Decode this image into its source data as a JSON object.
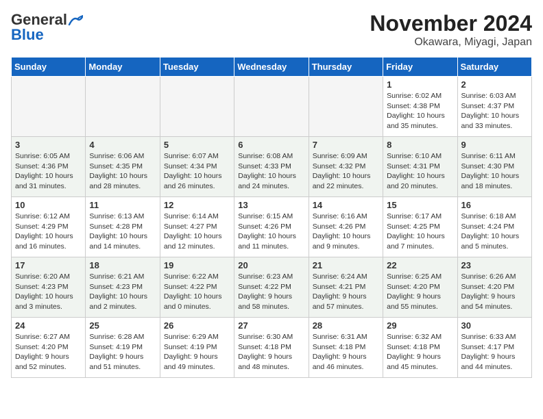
{
  "header": {
    "logo_general": "General",
    "logo_blue": "Blue",
    "month_title": "November 2024",
    "location": "Okawara, Miyagi, Japan"
  },
  "weekdays": [
    "Sunday",
    "Monday",
    "Tuesday",
    "Wednesday",
    "Thursday",
    "Friday",
    "Saturday"
  ],
  "weeks": [
    [
      {
        "day": "",
        "detail": ""
      },
      {
        "day": "",
        "detail": ""
      },
      {
        "day": "",
        "detail": ""
      },
      {
        "day": "",
        "detail": ""
      },
      {
        "day": "",
        "detail": ""
      },
      {
        "day": "1",
        "detail": "Sunrise: 6:02 AM\nSunset: 4:38 PM\nDaylight: 10 hours\nand 35 minutes."
      },
      {
        "day": "2",
        "detail": "Sunrise: 6:03 AM\nSunset: 4:37 PM\nDaylight: 10 hours\nand 33 minutes."
      }
    ],
    [
      {
        "day": "3",
        "detail": "Sunrise: 6:05 AM\nSunset: 4:36 PM\nDaylight: 10 hours\nand 31 minutes."
      },
      {
        "day": "4",
        "detail": "Sunrise: 6:06 AM\nSunset: 4:35 PM\nDaylight: 10 hours\nand 28 minutes."
      },
      {
        "day": "5",
        "detail": "Sunrise: 6:07 AM\nSunset: 4:34 PM\nDaylight: 10 hours\nand 26 minutes."
      },
      {
        "day": "6",
        "detail": "Sunrise: 6:08 AM\nSunset: 4:33 PM\nDaylight: 10 hours\nand 24 minutes."
      },
      {
        "day": "7",
        "detail": "Sunrise: 6:09 AM\nSunset: 4:32 PM\nDaylight: 10 hours\nand 22 minutes."
      },
      {
        "day": "8",
        "detail": "Sunrise: 6:10 AM\nSunset: 4:31 PM\nDaylight: 10 hours\nand 20 minutes."
      },
      {
        "day": "9",
        "detail": "Sunrise: 6:11 AM\nSunset: 4:30 PM\nDaylight: 10 hours\nand 18 minutes."
      }
    ],
    [
      {
        "day": "10",
        "detail": "Sunrise: 6:12 AM\nSunset: 4:29 PM\nDaylight: 10 hours\nand 16 minutes."
      },
      {
        "day": "11",
        "detail": "Sunrise: 6:13 AM\nSunset: 4:28 PM\nDaylight: 10 hours\nand 14 minutes."
      },
      {
        "day": "12",
        "detail": "Sunrise: 6:14 AM\nSunset: 4:27 PM\nDaylight: 10 hours\nand 12 minutes."
      },
      {
        "day": "13",
        "detail": "Sunrise: 6:15 AM\nSunset: 4:26 PM\nDaylight: 10 hours\nand 11 minutes."
      },
      {
        "day": "14",
        "detail": "Sunrise: 6:16 AM\nSunset: 4:26 PM\nDaylight: 10 hours\nand 9 minutes."
      },
      {
        "day": "15",
        "detail": "Sunrise: 6:17 AM\nSunset: 4:25 PM\nDaylight: 10 hours\nand 7 minutes."
      },
      {
        "day": "16",
        "detail": "Sunrise: 6:18 AM\nSunset: 4:24 PM\nDaylight: 10 hours\nand 5 minutes."
      }
    ],
    [
      {
        "day": "17",
        "detail": "Sunrise: 6:20 AM\nSunset: 4:23 PM\nDaylight: 10 hours\nand 3 minutes."
      },
      {
        "day": "18",
        "detail": "Sunrise: 6:21 AM\nSunset: 4:23 PM\nDaylight: 10 hours\nand 2 minutes."
      },
      {
        "day": "19",
        "detail": "Sunrise: 6:22 AM\nSunset: 4:22 PM\nDaylight: 10 hours\nand 0 minutes."
      },
      {
        "day": "20",
        "detail": "Sunrise: 6:23 AM\nSunset: 4:22 PM\nDaylight: 9 hours\nand 58 minutes."
      },
      {
        "day": "21",
        "detail": "Sunrise: 6:24 AM\nSunset: 4:21 PM\nDaylight: 9 hours\nand 57 minutes."
      },
      {
        "day": "22",
        "detail": "Sunrise: 6:25 AM\nSunset: 4:20 PM\nDaylight: 9 hours\nand 55 minutes."
      },
      {
        "day": "23",
        "detail": "Sunrise: 6:26 AM\nSunset: 4:20 PM\nDaylight: 9 hours\nand 54 minutes."
      }
    ],
    [
      {
        "day": "24",
        "detail": "Sunrise: 6:27 AM\nSunset: 4:20 PM\nDaylight: 9 hours\nand 52 minutes."
      },
      {
        "day": "25",
        "detail": "Sunrise: 6:28 AM\nSunset: 4:19 PM\nDaylight: 9 hours\nand 51 minutes."
      },
      {
        "day": "26",
        "detail": "Sunrise: 6:29 AM\nSunset: 4:19 PM\nDaylight: 9 hours\nand 49 minutes."
      },
      {
        "day": "27",
        "detail": "Sunrise: 6:30 AM\nSunset: 4:18 PM\nDaylight: 9 hours\nand 48 minutes."
      },
      {
        "day": "28",
        "detail": "Sunrise: 6:31 AM\nSunset: 4:18 PM\nDaylight: 9 hours\nand 46 minutes."
      },
      {
        "day": "29",
        "detail": "Sunrise: 6:32 AM\nSunset: 4:18 PM\nDaylight: 9 hours\nand 45 minutes."
      },
      {
        "day": "30",
        "detail": "Sunrise: 6:33 AM\nSunset: 4:17 PM\nDaylight: 9 hours\nand 44 minutes."
      }
    ]
  ]
}
